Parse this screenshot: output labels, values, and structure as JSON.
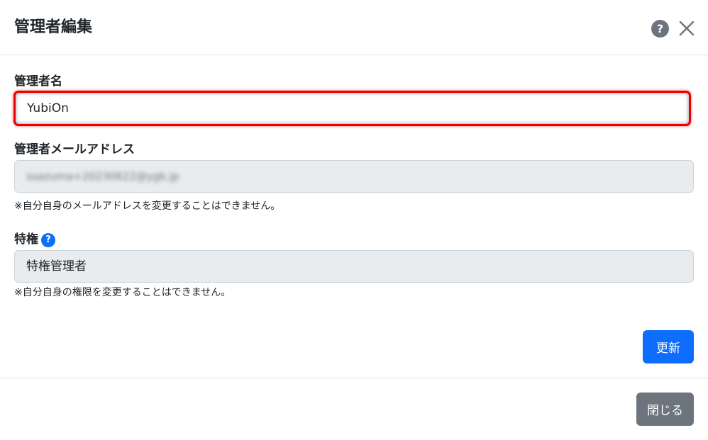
{
  "modal": {
    "title": "管理者編集",
    "help_icon": "question-circle-icon",
    "help_glyph": "?",
    "close_icon": "close-icon"
  },
  "form": {
    "name_label": "管理者名",
    "name_value": "YubiOn",
    "email_label": "管理者メールアドレス",
    "email_value": "ssazuma+20230622@ygk.jp",
    "email_note": "※自分自身のメールアドレスを変更することはできません。",
    "privilege_label": "特権",
    "privilege_info_icon": "question-circle-icon",
    "privilege_info_glyph": "?",
    "privilege_value": "特権管理者",
    "privilege_note": "※自分自身の権限を変更することはできません。"
  },
  "actions": {
    "update_label": "更新",
    "close_label": "閉じる"
  },
  "colors": {
    "primary": "#0d6efd",
    "secondary": "#6c757d",
    "highlight_border": "#e60000",
    "disabled_bg": "#e9ecef"
  }
}
